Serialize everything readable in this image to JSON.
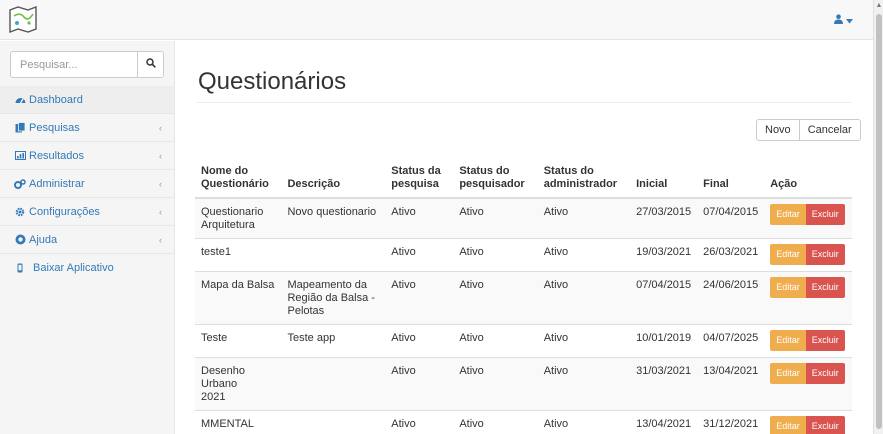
{
  "header": {
    "logo": "map-logo-icon",
    "user_icon": "user-icon",
    "dropdown_icon": "caret-down-icon"
  },
  "sidebar": {
    "search_placeholder": "Pesquisar...",
    "items": [
      {
        "label": "Dashboard",
        "icon": "dashboard-icon",
        "has_submenu": false,
        "active": true
      },
      {
        "label": "Pesquisas",
        "icon": "files-icon",
        "has_submenu": true
      },
      {
        "label": "Resultados",
        "icon": "chart-icon",
        "has_submenu": true
      },
      {
        "label": "Administrar",
        "icon": "cogs-icon",
        "has_submenu": true
      },
      {
        "label": "Configurações",
        "icon": "gear-icon",
        "has_submenu": true
      },
      {
        "label": "Ajuda",
        "icon": "question-icon",
        "has_submenu": true
      },
      {
        "label": "Baixar Aplicativo",
        "icon": "mobile-icon",
        "has_submenu": false
      }
    ]
  },
  "main": {
    "title": "Questionários",
    "new_label": "Novo",
    "cancel_label": "Cancelar",
    "columns": {
      "name": [
        "Nome do",
        "Questionário"
      ],
      "description": "Descrição",
      "survey_status": [
        "Status da",
        "pesquisa"
      ],
      "researcher_status": [
        "Status do",
        "pesquisador"
      ],
      "admin_status": [
        "Status do",
        "administrador"
      ],
      "start": "Inicial",
      "end": "Final",
      "action": "Ação"
    },
    "edit_label": "Editar",
    "delete_label": "Excluir",
    "rows": [
      {
        "name": [
          "Questionario",
          "Arquitetura"
        ],
        "description": [
          "Novo questionario"
        ],
        "survey_status": "Ativo",
        "researcher_status": "Ativo",
        "admin_status": "Ativo",
        "start": "27/03/2015",
        "end": "07/04/2015"
      },
      {
        "name": [
          "teste1"
        ],
        "description": [
          ""
        ],
        "survey_status": "Ativo",
        "researcher_status": "Ativo",
        "admin_status": "Ativo",
        "start": "19/03/2021",
        "end": "26/03/2021"
      },
      {
        "name": [
          "Mapa da Balsa"
        ],
        "description": [
          "Mapeamento da",
          "Região da Balsa -",
          "Pelotas"
        ],
        "survey_status": "Ativo",
        "researcher_status": "Ativo",
        "admin_status": "Ativo",
        "start": "07/04/2015",
        "end": "24/06/2015"
      },
      {
        "name": [
          "Teste"
        ],
        "description": [
          "Teste app"
        ],
        "survey_status": "Ativo",
        "researcher_status": "Ativo",
        "admin_status": "Ativo",
        "start": "10/01/2019",
        "end": "04/07/2025"
      },
      {
        "name": [
          "Desenho Urbano",
          "2021"
        ],
        "description": [
          ""
        ],
        "survey_status": "Ativo",
        "researcher_status": "Ativo",
        "admin_status": "Ativo",
        "start": "31/03/2021",
        "end": "13/04/2021"
      },
      {
        "name": [
          "MMENTAL"
        ],
        "description": [
          ""
        ],
        "survey_status": "Ativo",
        "researcher_status": "Ativo",
        "admin_status": "Ativo",
        "start": "13/04/2021",
        "end": "31/12/2021"
      }
    ]
  },
  "colors": {
    "link": "#337ab7",
    "edit": "#f0ad4e",
    "delete": "#d9534f"
  }
}
